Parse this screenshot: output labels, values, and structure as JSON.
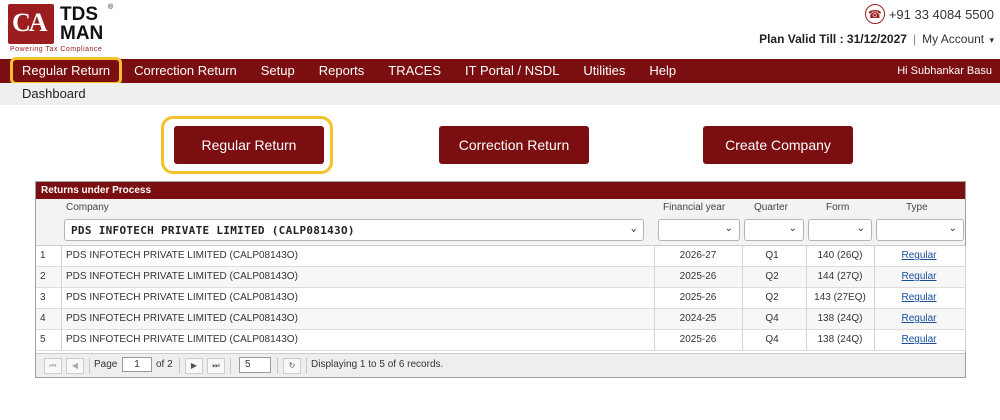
{
  "brand": {
    "logo_mark": "CA",
    "logo_line1": "TDS",
    "logo_line2": "MAN",
    "tagline": "Powering Tax Compliance",
    "reg_mark": "®"
  },
  "header": {
    "phone": "+91 33 4084 5500",
    "phone_icon": "phone-icon",
    "plan_label": "Plan Valid Till : 31/12/2027",
    "separator": "|",
    "account_label": "My Account",
    "account_caret": "▾"
  },
  "nav": {
    "items": [
      {
        "label": "Regular Return"
      },
      {
        "label": "Correction Return"
      },
      {
        "label": "Setup"
      },
      {
        "label": "Reports"
      },
      {
        "label": "TRACES"
      },
      {
        "label": "IT Portal / NSDL"
      },
      {
        "label": "Utilities"
      },
      {
        "label": "Help"
      }
    ],
    "greeting": "Hi Subhankar Basu"
  },
  "subnav": {
    "label": "Dashboard"
  },
  "actions": {
    "regular_return": "Regular Return",
    "correction_return": "Correction Return",
    "create_company": "Create Company"
  },
  "grid": {
    "title": "Returns under Process",
    "headers": {
      "company": "Company",
      "financial_year": "Financial year",
      "quarter": "Quarter",
      "form": "Form",
      "type": "Type"
    },
    "filters": {
      "company": "PDS INFOTECH PRIVATE LIMITED (CALP08143O)",
      "chevron": "⌄"
    },
    "rows": [
      {
        "num": "1",
        "company": "PDS INFOTECH PRIVATE LIMITED (CALP08143O)",
        "fy": "2026-27",
        "quarter": "Q1",
        "form": "140 (26Q)",
        "type": "Regular"
      },
      {
        "num": "2",
        "company": "PDS INFOTECH PRIVATE LIMITED (CALP08143O)",
        "fy": "2025-26",
        "quarter": "Q2",
        "form": "144 (27Q)",
        "type": "Regular"
      },
      {
        "num": "3",
        "company": "PDS INFOTECH PRIVATE LIMITED (CALP08143O)",
        "fy": "2025-26",
        "quarter": "Q2",
        "form": "143 (27EQ)",
        "type": "Regular"
      },
      {
        "num": "4",
        "company": "PDS INFOTECH PRIVATE LIMITED (CALP08143O)",
        "fy": "2024-25",
        "quarter": "Q4",
        "form": "138 (24Q)",
        "type": "Regular"
      },
      {
        "num": "5",
        "company": "PDS INFOTECH PRIVATE LIMITED (CALP08143O)",
        "fy": "2025-26",
        "quarter": "Q4",
        "form": "138 (24Q)",
        "type": "Regular"
      }
    ],
    "pager": {
      "page_label": "Page",
      "page_value": "1",
      "of_label": "of 2",
      "page_size": "5",
      "status": "Displaying 1 to 5 of 6 records.",
      "first": "⏮",
      "prev": "◀",
      "next": "▶",
      "last": "⏭",
      "refresh": "↻"
    }
  }
}
